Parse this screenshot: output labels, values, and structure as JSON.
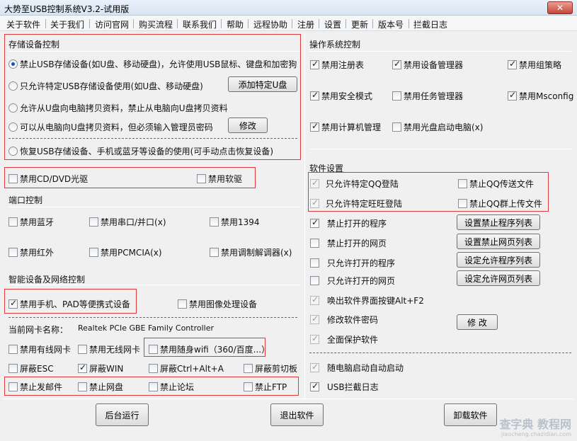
{
  "window": {
    "title": "大势至USB控制系统V3.2-试用版",
    "close_label": "✕"
  },
  "menu": [
    "关于软件",
    "关于我们",
    "访问官网",
    "购买流程",
    "联系我们",
    "帮助",
    "远程协助",
    "注册",
    "设置",
    "更新",
    "版本号",
    "拦截日志"
  ],
  "storage": {
    "title": "存储设备控制",
    "opt1": "禁止USB存储设备(如U盘、移动硬盘)，允许使用USB鼠标、键盘和加密狗",
    "opt2": "只允许特定USB存储设备使用(如U盘、移动硬盘)",
    "opt2_button": "添加特定U盘",
    "opt3": "允许从U盘向电脑拷贝资料，禁止从电脑向U盘拷贝资料",
    "opt4": "可以从电脑向U盘拷贝资料，但必须输入管理员密码",
    "opt4_button": "修改",
    "opt5": "恢复USB存储设备、手机或蓝牙等设备的使用(可手动点击恢复设备)"
  },
  "drives": {
    "cd": "禁用CD/DVD光驱",
    "floppy": "禁用软驱"
  },
  "ports": {
    "title": "端口控制",
    "bluetooth": "禁用蓝牙",
    "serial": "禁用串口/并口(x)",
    "p1394": "禁用1394",
    "infrared": "禁用红外",
    "pcmcia": "禁用PCMCIA(x)",
    "modem": "禁用调制解调器(x)"
  },
  "smart": {
    "title": "智能设备及网络控制",
    "mobile": "禁用手机、PAD等便携式设备",
    "imaging": "禁用图像处理设备",
    "nic_label": "当前网卡名称：",
    "nic_value": "Realtek PCIe GBE Family Controller",
    "wired": "禁用有线网卡",
    "wireless": "禁用无线网卡",
    "wifi": "禁用随身wifi（360/百度...）",
    "esc": "屏蔽ESC",
    "win": "屏蔽WIN",
    "cad": "屏蔽Ctrl+Alt+A",
    "clipboard": "屏蔽剪切板",
    "email": "禁止发邮件",
    "netdisk": "禁止网盘",
    "forum": "禁止论坛",
    "ftp": "禁止FTP"
  },
  "os": {
    "title": "操作系统控制",
    "registry": "禁用注册表",
    "devmgr": "禁用设备管理器",
    "gpedit": "禁用组策略",
    "safemode": "禁用安全模式",
    "taskmgr": "禁用任务管理器",
    "msconfig": "禁用Msconfig",
    "compmgmt": "禁用计算机管理",
    "cdboot": "禁用光盘启动电脑(x)"
  },
  "software": {
    "title": "软件设置",
    "qq_only": "只允许特定QQ登陆",
    "qq_file": "禁止QQ传送文件",
    "ww_only": "只允许特定旺旺登陆",
    "qq_group": "禁止QQ群上传文件",
    "block_prog": "禁止打开的程序",
    "block_prog_btn": "设置禁止程序列表",
    "block_web": "禁止打开的网页",
    "block_web_btn": "设置禁止网页列表",
    "allow_prog": "只允许打开的程序",
    "allow_prog_btn": "设定允许程序列表",
    "allow_web": "只允许打开的网页",
    "allow_web_btn": "设定允许网页列表",
    "hotkey": "唤出软件界面按键Alt+F2",
    "password": "修改软件密码",
    "password_btn": "修 改",
    "protect": "全面保护软件",
    "autostart": "随电脑启动自动启动",
    "usblog": "USB拦截日志"
  },
  "bottom": {
    "background": "后台运行",
    "exit": "退出软件",
    "uninstall": "卸载软件"
  },
  "watermark": {
    "main": "查字典 教程网",
    "sub": "jiaocheng.chazidian.com"
  }
}
